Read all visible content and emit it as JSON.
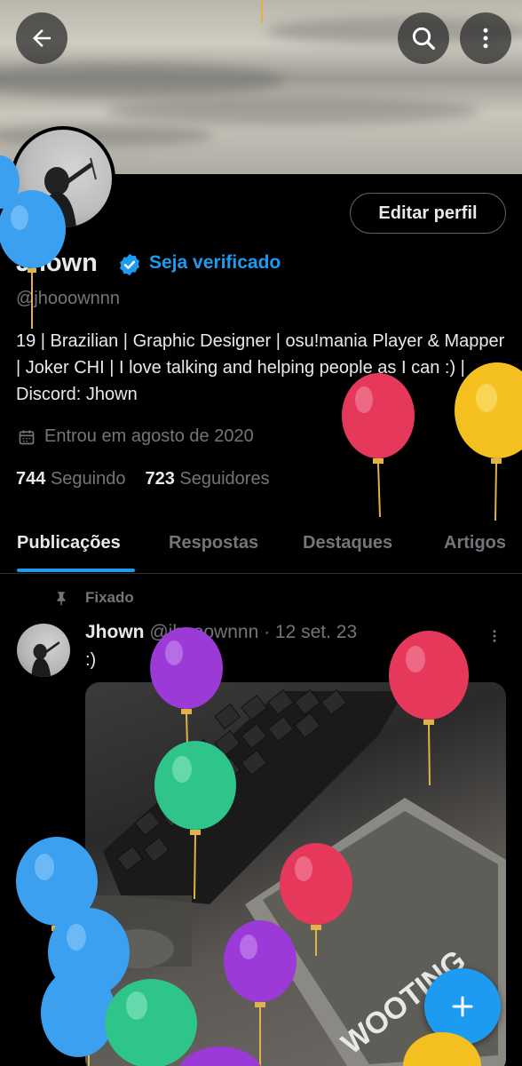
{
  "header": {
    "back_icon": "arrow-left-icon",
    "search_icon": "search-icon",
    "more_icon": "more-vertical-icon"
  },
  "profile": {
    "edit_label": "Editar perfil",
    "name": "Jhown",
    "verify_label": "Seja verificado",
    "handle": "@jhooownnn",
    "bio": "19 | Brazilian | Graphic Designer | osu!mania Player & Mapper | Joker CHI | I love talking and helping people as I can :) | Discord: Jhown",
    "joined": "Entrou em agosto de 2020",
    "following_count": "744",
    "following_label": "Seguindo",
    "followers_count": "723",
    "followers_label": "Seguidores"
  },
  "tabs": [
    "Publicações",
    "Respostas",
    "Destaques",
    "Artigos"
  ],
  "post": {
    "pinned_label": "Fixado",
    "author": "Jhown",
    "meta": "@jhooownnn · 12 set. 23",
    "text": ":)",
    "image_text": "WOOTING"
  },
  "colors": {
    "accent": "#1d9bf0",
    "background": "#000000",
    "muted": "#71767b"
  }
}
